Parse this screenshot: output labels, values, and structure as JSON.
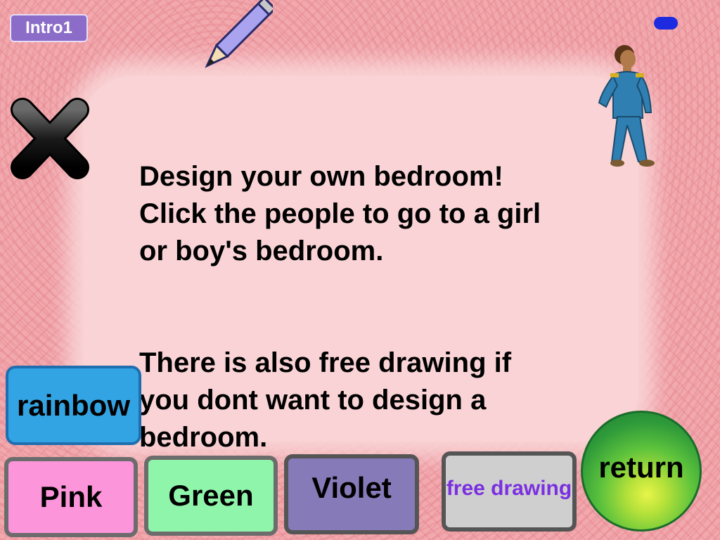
{
  "badge": {
    "label": "Intro1"
  },
  "message": {
    "paragraph1": "Design your own bedroom!\nClick the people to go to a girl\nor boy's bedroom.",
    "paragraph2": "There is also free drawing if\nyou dont want to design a\nbedroom."
  },
  "buttons": {
    "rainbow": "rainbow",
    "pink": "Pink",
    "green": "Green",
    "violet": "Violet",
    "free_drawing": "free drawing",
    "return": "return"
  },
  "icons": {
    "close": "close-icon",
    "pencil": "pencil-icon",
    "person": "person-icon",
    "indicator": "blue-indicator"
  },
  "colors": {
    "background_lace": "#f1a9ae",
    "rainbow": "#33a4e3",
    "pink": "#fd95da",
    "green": "#8ff5ab",
    "violet": "#867ab8",
    "free_drawing": "#cfcfcf",
    "free_drawing_text": "#7b2fe0",
    "return": "#5cc23c",
    "badge": "#8c6cc9"
  }
}
